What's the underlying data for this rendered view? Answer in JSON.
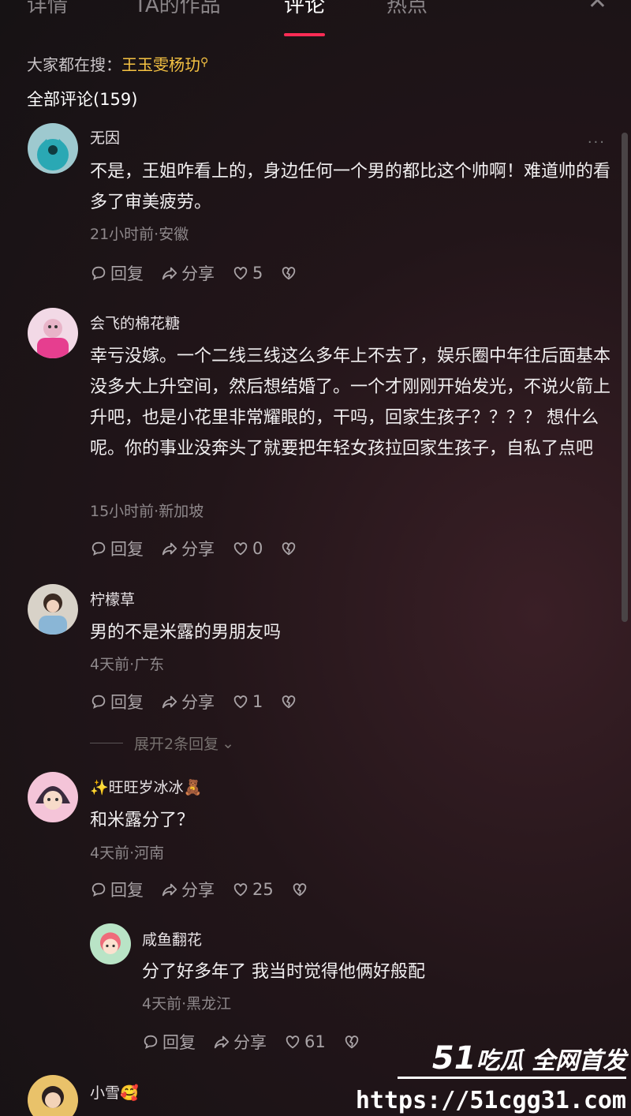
{
  "tabs": [
    {
      "label": "详情"
    },
    {
      "label": "TA的作品"
    },
    {
      "label": "评论"
    },
    {
      "label": "热点"
    }
  ],
  "close_icon": "close-icon",
  "search": {
    "prefix": "大家都在搜：",
    "term": "王玉雯杨玏"
  },
  "comments_header": "全部评论(159)",
  "colors": {
    "accent": "#fe2c55",
    "hot": "#f6c343"
  },
  "comments": [
    {
      "name": "无因",
      "text": "不是，王姐咋看上的，身边任何一个男的都比这个帅啊！难道帅的看多了审美疲劳。",
      "meta": "21小时前·安徽",
      "reply": "回复",
      "share": "分享",
      "likes": "5"
    },
    {
      "name": "会飞的棉花糖",
      "text": "幸亏没嫁。一个二线三线这么多年上不去了，娱乐圈中年往后面基本没多大上升空间，然后想结婚了。一个才刚刚开始发光，不说火箭上升吧，也是小花里非常耀眼的，干吗，回家生孩子？？？？ 想什么呢。你的事业没奔头了就要把年轻女孩拉回家生孩子，自私了点吧",
      "meta": "15小时前·新加坡",
      "reply": "回复",
      "share": "分享",
      "likes": "0"
    },
    {
      "name": "柠檬草",
      "text": "男的不是米露的男朋友吗",
      "meta": "4天前·广东",
      "reply": "回复",
      "share": "分享",
      "likes": "1"
    },
    {
      "name": "✨旺旺岁冰冰🧸",
      "text": "和米露分了？",
      "meta": "4天前·河南",
      "reply": "回复",
      "share": "分享",
      "likes": "25"
    },
    {
      "name": "咸鱼翻花",
      "text": "分了好多年了  我当时觉得他俩好般配",
      "meta": "4天前·黑龙江",
      "reply": "回复",
      "share": "分享",
      "likes": "61"
    },
    {
      "name": "小雪🥰"
    }
  ],
  "expand_replies": "展开2条回复",
  "watermark": {
    "brand_num": "51",
    "brand_text": "吃瓜 全网首发",
    "url": "https://51cgg31.com"
  }
}
